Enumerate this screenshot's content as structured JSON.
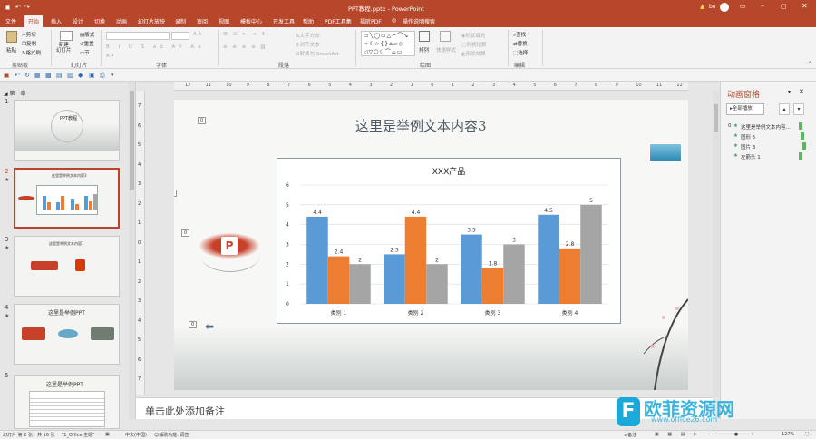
{
  "title": {
    "filename": "PPT教程.pptx",
    "sep": " - ",
    "app": "PowerPoint",
    "user": "bo"
  },
  "tabs": [
    "文件",
    "开始",
    "插入",
    "设计",
    "切换",
    "动画",
    "幻灯片放映",
    "录制",
    "审阅",
    "视图",
    "模板中心",
    "开发工具",
    "帮助",
    "PDF工具集",
    "福昕PDF",
    "操作说明搜索"
  ],
  "ribbon": {
    "clipboard": {
      "paste": "粘贴",
      "cut": "剪切",
      "copy": "复制",
      "format": "格式刷",
      "label": "剪贴板"
    },
    "slides": {
      "new": "新建\n幻灯片",
      "layout": "版式",
      "reset": "重置",
      "section": "节",
      "label": "幻灯片"
    },
    "font": {
      "label": "字体"
    },
    "paragraph": {
      "textdir": "文字方向",
      "align": "对齐文本",
      "smartart": "转换为 SmartArt",
      "label": "段落"
    },
    "drawing": {
      "arrange": "排列",
      "quickstyles": "快速样式",
      "fill": "形状填充",
      "outline": "形状轮廓",
      "effects": "形状效果",
      "label": "绘图"
    },
    "editing": {
      "find": "查找",
      "replace": "替换",
      "select": "选择",
      "label": "编辑"
    }
  },
  "thumbs": {
    "section": "第一章",
    "nums": [
      "1",
      "2",
      "3",
      "4",
      "5"
    ],
    "t1": "PPT教程",
    "t2": "这里是举例文本内容3",
    "t3": "这里是举例文本内容1",
    "t4": "这里是举例PPT",
    "t5": "这里是举例PPT"
  },
  "slide": {
    "title": "这里是举例文本内容3",
    "tags": [
      "0",
      "0",
      "0",
      "0"
    ]
  },
  "chart_data": {
    "type": "bar",
    "title": "XXX产品",
    "categories": [
      "类别 1",
      "类别 2",
      "类别 3",
      "类别 4"
    ],
    "series": [
      {
        "values": [
          4.4,
          2.5,
          3.5,
          4.5
        ],
        "color": "#5b9bd5"
      },
      {
        "values": [
          2.4,
          4.4,
          1.8,
          2.8
        ],
        "color": "#ed7d31"
      },
      {
        "values": [
          2,
          2,
          3,
          5
        ],
        "color": "#a5a5a5"
      }
    ],
    "yticks": [
      "0",
      "1",
      "2",
      "3",
      "4",
      "5",
      "6"
    ],
    "ylim": [
      0,
      6
    ],
    "grid": true
  },
  "notes": {
    "placeholder": "单击此处添加备注"
  },
  "anim": {
    "title": "动画窗格",
    "play": "全部播放",
    "items": [
      {
        "idx": "0",
        "label": "这里是举例文本内容..."
      },
      {
        "idx": "",
        "label": "图形 5"
      },
      {
        "idx": "",
        "label": "图片 3"
      },
      {
        "idx": "",
        "label": "左箭头 1"
      }
    ]
  },
  "ruler_h": [
    "12",
    "11",
    "10",
    "9",
    "8",
    "7",
    "6",
    "5",
    "4",
    "3",
    "2",
    "1",
    "0",
    "1",
    "2",
    "3",
    "4",
    "5",
    "6",
    "7",
    "8",
    "9",
    "10",
    "11",
    "12"
  ],
  "ruler_v": [
    "7",
    "6",
    "5",
    "4",
    "3",
    "2",
    "1",
    "0",
    "1",
    "2",
    "3",
    "4",
    "5",
    "6",
    "7"
  ],
  "status": {
    "slide": "幻灯片 第 2 张，共 16 张",
    "theme": "\"1_Office 主题\"",
    "lang": "中文(中国)",
    "access": "辅助功能: 调查",
    "notes": "备注",
    "zoom": "127%"
  },
  "watermark": {
    "text": "欧菲资源网",
    "sub": "www.office26.com"
  },
  "colors": {
    "accent": "#b7472a"
  }
}
